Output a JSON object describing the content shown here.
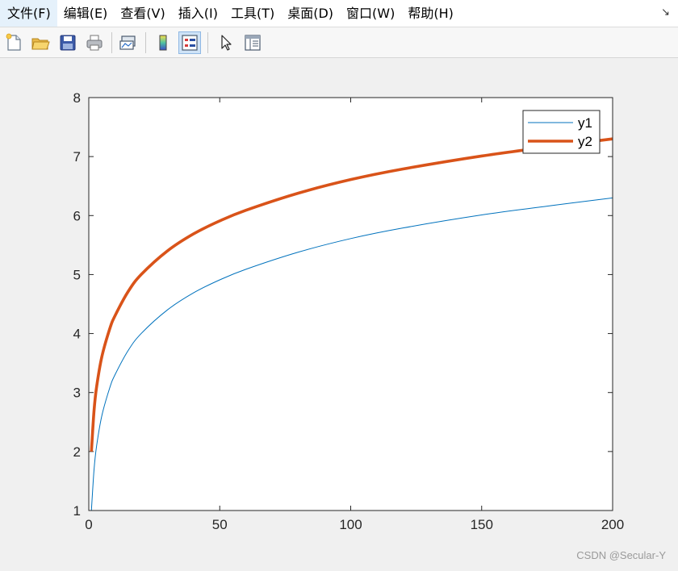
{
  "menu": {
    "items": [
      "文件(F)",
      "编辑(E)",
      "查看(V)",
      "插入(I)",
      "工具(T)",
      "桌面(D)",
      "窗口(W)",
      "帮助(H)"
    ],
    "corner_glyph": "↘"
  },
  "toolbar": {
    "buttons": [
      {
        "icon": "new-figure-icon",
        "active": false
      },
      {
        "icon": "open-file-icon",
        "active": false
      },
      {
        "icon": "save-icon",
        "active": false
      },
      {
        "icon": "print-icon",
        "active": false
      },
      {
        "icon": "link-plot-icon",
        "active": false
      },
      {
        "icon": "insert-colorbar-icon",
        "active": false
      },
      {
        "icon": "insert-legend-icon",
        "active": true
      },
      {
        "icon": "edit-plot-arrow-icon",
        "active": false
      },
      {
        "icon": "property-inspector-icon",
        "active": false
      }
    ]
  },
  "chart_data": {
    "type": "line",
    "title": "",
    "xlabel": "",
    "ylabel": "",
    "xlim": [
      0,
      200
    ],
    "ylim": [
      1,
      8
    ],
    "xticks": [
      0,
      50,
      100,
      150,
      200
    ],
    "yticks": [
      1,
      2,
      3,
      4,
      5,
      6,
      7,
      8
    ],
    "grid": false,
    "legend_position": "top-right",
    "series": [
      {
        "name": "y1",
        "color": "#0072bd",
        "line_style": "thin",
        "x": [
          1,
          2,
          3,
          5,
          8,
          10,
          15,
          20,
          30,
          40,
          50,
          60,
          80,
          100,
          120,
          150,
          175,
          200
        ],
        "y": [
          1.0,
          1.69,
          2.1,
          2.61,
          3.08,
          3.3,
          3.71,
          4.0,
          4.4,
          4.69,
          4.91,
          5.09,
          5.38,
          5.61,
          5.79,
          6.01,
          6.16,
          6.3
        ]
      },
      {
        "name": "y2",
        "color": "#d95319",
        "line_style": "thick",
        "x": [
          1,
          2,
          3,
          5,
          8,
          10,
          15,
          20,
          30,
          40,
          50,
          60,
          80,
          100,
          120,
          150,
          175,
          200
        ],
        "y": [
          2.0,
          2.69,
          3.1,
          3.61,
          4.08,
          4.3,
          4.71,
          5.0,
          5.4,
          5.69,
          5.91,
          6.09,
          6.38,
          6.61,
          6.79,
          7.01,
          7.16,
          7.3
        ]
      }
    ]
  },
  "watermark": "CSDN @Secular-Y"
}
